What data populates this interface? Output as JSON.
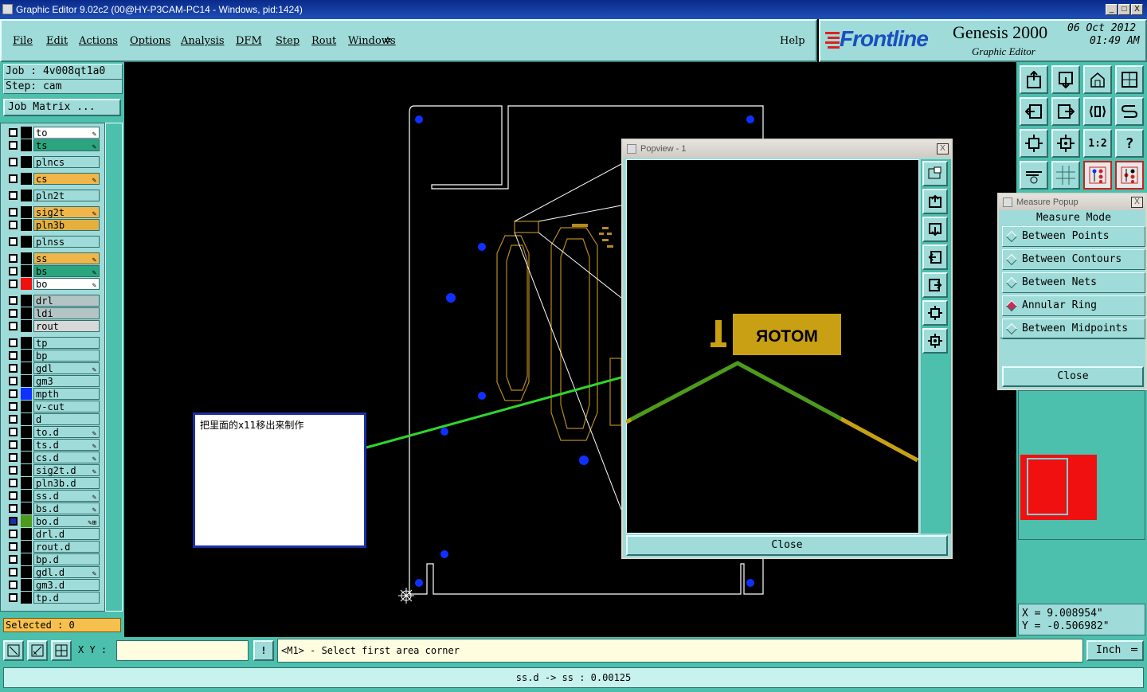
{
  "window": {
    "title": "Graphic Editor 9.02c2 (00@HY-P3CAM-PC14 - Windows, pid:1424)",
    "min": "_",
    "max": "□",
    "close": "X"
  },
  "menu": {
    "file": "File",
    "edit": "Edit",
    "actions": "Actions",
    "options": "Options",
    "analysis": "Analysis",
    "dfm": "DFM",
    "step": "Step",
    "rout": "Rout",
    "windows": "Windows",
    "help": "Help"
  },
  "brand": {
    "logo": "Frontline",
    "product": "Genesis 2000",
    "subtitle": "Graphic Editor",
    "date": "06 Oct 2012",
    "time": "01:49 AM"
  },
  "job": {
    "job_line": "Job : 4v008qt1a0",
    "step_line": "Step: cam",
    "matrix_button": "Job Matrix ..."
  },
  "layers": [
    {
      "name": "to",
      "color": "#ffffff",
      "edit": "✎"
    },
    {
      "name": "ts",
      "color": "#2aa57e",
      "edit": "✎"
    },
    {
      "name": "plncs",
      "color": "#9fdbd8",
      "edit": ""
    },
    {
      "name": "cs",
      "color": "#f0b64a",
      "edit": "✎"
    },
    {
      "name": "pln2t",
      "color": "#9fdbd8",
      "edit": ""
    },
    {
      "name": "sig2t",
      "color": "#f0b64a",
      "edit": "✎"
    },
    {
      "name": "pln3b",
      "color": "#e3b040",
      "edit": ""
    },
    {
      "name": "plnss",
      "color": "#9fdbd8",
      "edit": ""
    },
    {
      "name": "ss",
      "color": "#f0b64a",
      "edit": "✎"
    },
    {
      "name": "bs",
      "color": "#2aa57e",
      "edit": "✎"
    },
    {
      "name": "bo",
      "color": "#ffffff",
      "edit": "✎"
    },
    {
      "name": "drl",
      "color": "#b4c4c4",
      "edit": ""
    },
    {
      "name": "ldi",
      "color": "#b4c4c4",
      "edit": ""
    },
    {
      "name": "rout",
      "color": "#d8d8d8",
      "edit": ""
    },
    {
      "name": "tp",
      "color": "#9fdbd8",
      "edit": ""
    },
    {
      "name": "bp",
      "color": "#9fdbd8",
      "edit": ""
    },
    {
      "name": "gdl",
      "color": "#9fdbd8",
      "edit": "✎"
    },
    {
      "name": "gm3",
      "color": "#9fdbd8",
      "edit": ""
    },
    {
      "name": "mpth",
      "color": "#9fdbd8",
      "edit": ""
    },
    {
      "name": "v-cut",
      "color": "#9fdbd8",
      "edit": ""
    },
    {
      "name": "d",
      "color": "#9fdbd8",
      "edit": ""
    },
    {
      "name": "to.d",
      "color": "#9fdbd8",
      "edit": "✎"
    },
    {
      "name": "ts.d",
      "color": "#9fdbd8",
      "edit": "✎"
    },
    {
      "name": "cs.d",
      "color": "#9fdbd8",
      "edit": "✎"
    },
    {
      "name": "sig2t.d",
      "color": "#9fdbd8",
      "edit": "✎"
    },
    {
      "name": "pln3b.d",
      "color": "#9fdbd8",
      "edit": ""
    },
    {
      "name": "ss.d",
      "color": "#9fdbd8",
      "edit": "✎"
    },
    {
      "name": "bs.d",
      "color": "#9fdbd8",
      "edit": "✎"
    },
    {
      "name": "bo.d",
      "color": "#9fdbd8",
      "edit": "✎⊞"
    },
    {
      "name": "drl.d",
      "color": "#9fdbd8",
      "edit": ""
    },
    {
      "name": "rout.d",
      "color": "#9fdbd8",
      "edit": ""
    },
    {
      "name": "bp.d",
      "color": "#9fdbd8",
      "edit": ""
    },
    {
      "name": "gdl.d",
      "color": "#9fdbd8",
      "edit": "✎"
    },
    {
      "name": "gm3.d",
      "color": "#9fdbd8",
      "edit": ""
    },
    {
      "name": "tp.d",
      "color": "#9fdbd8",
      "edit": ""
    }
  ],
  "selected": "Selected : 0",
  "note": {
    "text": "把里面的x11移出来制作"
  },
  "popview": {
    "title": "Popview - 1",
    "label": "MOTOR",
    "close": "Close"
  },
  "measure": {
    "title": "Measure Popup",
    "heading": "Measure Mode",
    "options": [
      "Between Points",
      "Between Contours",
      "Between Nets",
      "Annular Ring",
      "Between Midpoints"
    ],
    "selected_index": 3,
    "close": "Close"
  },
  "coords": {
    "x": "X = 9.008954\"",
    "y": "Y = -0.506982\""
  },
  "toolbar_icons": [
    "zoom-home-icon",
    "zoom-out-icon",
    "home-icon",
    "window-icon",
    "pan-left-icon",
    "pan-right-icon",
    "flip-icon",
    "snap-icon",
    "fit-icon",
    "center-icon",
    "scale-1-2-icon",
    "help-icon",
    "tools-icon",
    "grid-icon",
    "layer-top-icon",
    "layer-bottom-icon"
  ],
  "scale_label": "1:2",
  "help_glyph": "?",
  "bottom": {
    "xy_label": "X Y :",
    "xy_value": "",
    "prompt": "<M1> - Select first area corner",
    "unit": "Inch"
  },
  "status": {
    "text": "ss.d -> ss : 0.00125"
  },
  "colors": {
    "panel": "#4cbfad",
    "cyan": "#9fdbd8",
    "canvas": "#000000",
    "accent_green": "#2ed62e",
    "pad_gold": "#c9a013"
  }
}
